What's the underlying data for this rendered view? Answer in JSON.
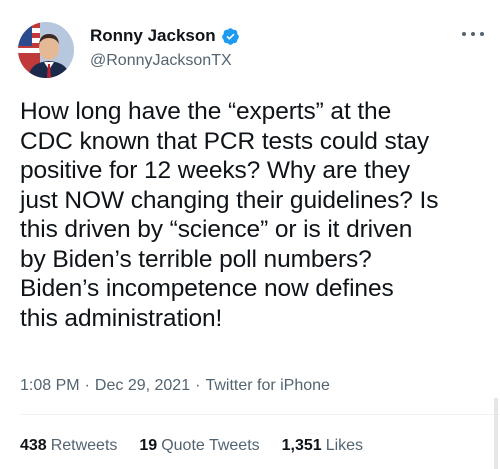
{
  "author": {
    "display_name": "Ronny Jackson",
    "handle": "@RonnyJacksonTX",
    "verified": true
  },
  "tweet": {
    "text": "How long have the “experts” at the\nCDC known that PCR tests could stay\npositive for 12 weeks? Why are they\njust NOW changing their guidelines? Is\nthis driven by “science” or is it driven\nby Biden’s terrible poll numbers?\nBiden’s incompetence now defines\nthis administration!",
    "time": "1:08 PM",
    "separator": "·",
    "date": "Dec 29, 2021",
    "source": "Twitter for iPhone"
  },
  "stats": {
    "retweets_count": "438",
    "retweets_label": "Retweets",
    "quote_count": "19",
    "quote_label": "Quote Tweets",
    "likes_count": "1,351",
    "likes_label": "Likes"
  },
  "icons": {
    "verified": "verified-badge-icon",
    "more": "more-options-icon"
  },
  "colors": {
    "verified_blue": "#1d9bf0",
    "text_primary": "#0f1419",
    "text_secondary": "#536471"
  }
}
